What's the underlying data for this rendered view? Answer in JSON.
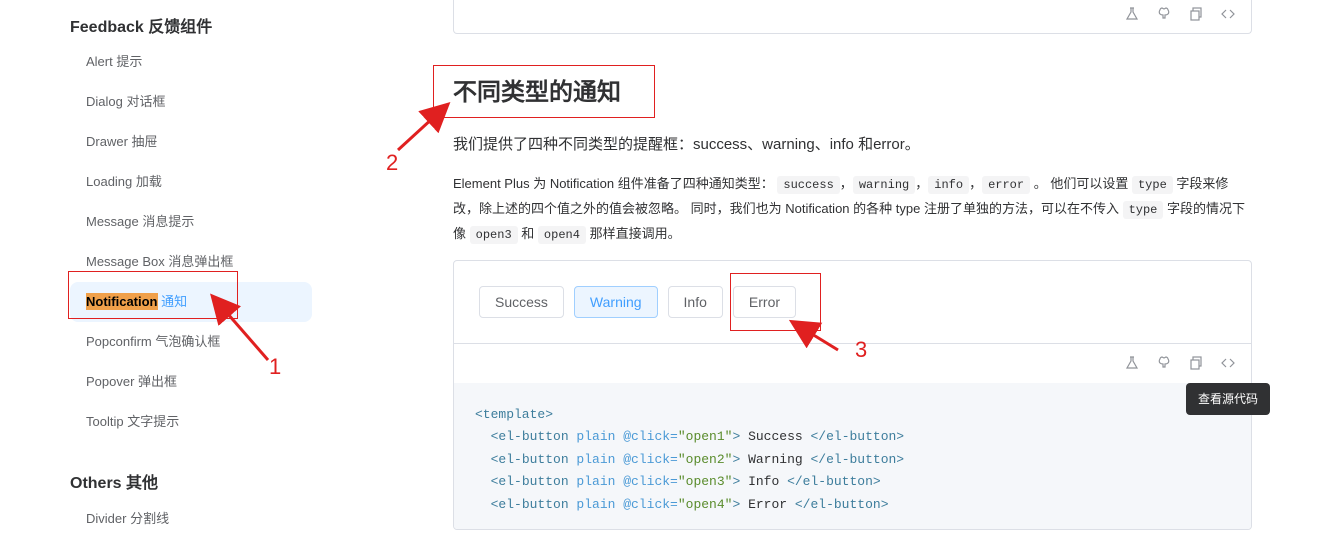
{
  "sidebar": {
    "group_feedback": "Feedback 反馈组件",
    "items": [
      {
        "label": "Alert 提示"
      },
      {
        "label": "Dialog 对话框"
      },
      {
        "label": "Drawer 抽屉"
      },
      {
        "label": "Loading 加载"
      },
      {
        "label": "Message 消息提示"
      },
      {
        "label": "Message Box 消息弹出框"
      },
      {
        "label_en": "Notification",
        "label_cn": "通知",
        "active": true
      },
      {
        "label": "Popconfirm 气泡确认框"
      },
      {
        "label": "Popover 弹出框"
      },
      {
        "label": "Tooltip 文字提示"
      }
    ],
    "group_others": "Others 其他",
    "partial_item": "Divider 分割线"
  },
  "toolbar_icons": [
    "flask-icon",
    "github-icon",
    "copy-icon",
    "code-icon"
  ],
  "main": {
    "section_title": "不同类型的通知",
    "lead": "我们提供了四种不同类型的提醒框：success、warning、info 和error。",
    "para": {
      "p1": "Element Plus 为 Notification 组件准备了四种通知类型：",
      "c1": "success",
      "sep1": "，",
      "c2": "warning",
      "sep2": "，",
      "c3": "info",
      "sep3": "，",
      "c4": "error",
      "p2": "。 他们可以设置",
      "c5": "type",
      "p3": "字段来修改，除上述的四个值之外的值会被忽略。 同时，我们也为 Notification 的各种 type 注册了单独的方法，可以在不传入",
      "c6": "type",
      "p4": "字段的情况下像",
      "c7": "open3",
      "p5": "和",
      "c8": "open4",
      "p6": "那样直接调用。"
    },
    "buttons": [
      "Success",
      "Warning",
      "Info",
      "Error"
    ],
    "tooltip": "查看源代码",
    "code": {
      "l1_tag": "<template>",
      "lines": [
        {
          "open": "<el-button",
          "attr": " plain @click=",
          "val": "\"open1\"",
          "close": ">",
          "text": " Success ",
          "end": "</el-button>"
        },
        {
          "open": "<el-button",
          "attr": " plain @click=",
          "val": "\"open2\"",
          "close": ">",
          "text": " Warning ",
          "end": "</el-button>"
        },
        {
          "open": "<el-button",
          "attr": " plain @click=",
          "val": "\"open3\"",
          "close": ">",
          "text": " Info ",
          "end": "</el-button>"
        },
        {
          "open": "<el-button",
          "attr": " plain @click=",
          "val": "\"open4\"",
          "close": ">",
          "text": " Error ",
          "end": "</el-button>"
        }
      ]
    }
  },
  "annotations": {
    "n1": "1",
    "n2": "2",
    "n3": "3"
  },
  "colors": {
    "annotation": "#e02020",
    "active_bg": "#ecf5ff",
    "highlight": "#f0a04a",
    "accent": "#409eff"
  }
}
